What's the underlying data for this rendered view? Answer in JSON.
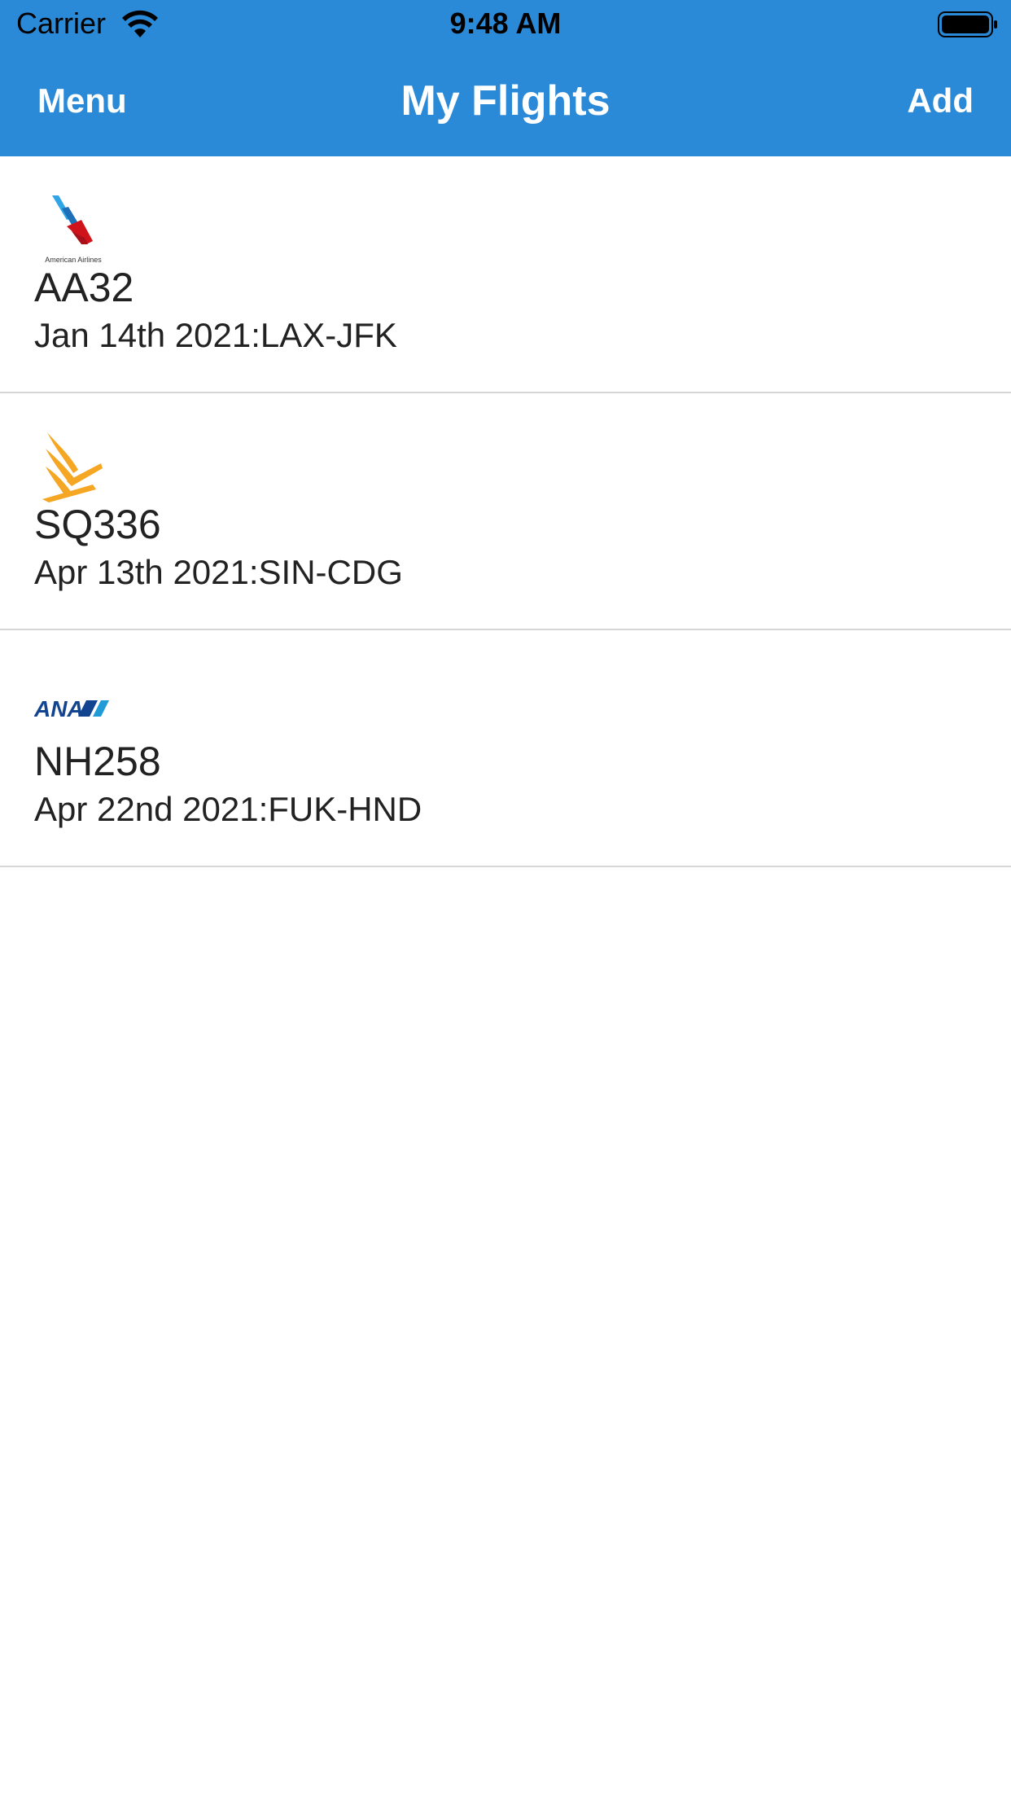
{
  "status_bar": {
    "carrier": "Carrier",
    "time": "9:48 AM"
  },
  "nav": {
    "left_label": "Menu",
    "title": "My Flights",
    "right_label": "Add"
  },
  "colors": {
    "header_bg": "#2b8ad8",
    "text": "#222222",
    "separator": "#d6d6d6"
  },
  "flights": [
    {
      "airline_icon": "american-airlines-logo",
      "airline_logo_text": "American Airlines",
      "flight_number": "AA32",
      "details": "Jan 14th 2021:LAX-JFK"
    },
    {
      "airline_icon": "singapore-airlines-logo",
      "flight_number": "SQ336",
      "details": "Apr 13th 2021:SIN-CDG"
    },
    {
      "airline_icon": "ana-logo",
      "airline_logo_text": "ANA",
      "flight_number": "NH258",
      "details": "Apr 22nd 2021:FUK-HND"
    }
  ]
}
